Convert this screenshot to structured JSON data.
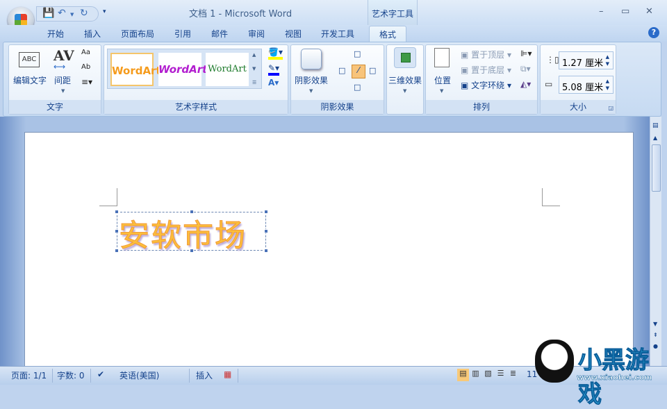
{
  "title": "文档 1 - Microsoft Word",
  "context_tab_group": "艺术字工具",
  "tabs": [
    "开始",
    "插入",
    "页面布局",
    "引用",
    "邮件",
    "审阅",
    "视图",
    "开发工具",
    "格式"
  ],
  "ribbon": {
    "text_group": {
      "label": "文字",
      "edit_text": "编辑文字",
      "spacing": "间距"
    },
    "wordart_styles": {
      "label": "艺术字样式",
      "samples": [
        "WordArt",
        "WordArt",
        "WordArt"
      ]
    },
    "shadow": {
      "label": "阴影效果",
      "button": "阴影效果"
    },
    "threed": {
      "button": "三维效果"
    },
    "arrange": {
      "label": "排列",
      "position": "位置",
      "bring_front": "置于顶层",
      "send_back": "置于底层",
      "text_wrap": "文字环绕"
    },
    "size": {
      "label": "大小",
      "height": "1.27 厘米",
      "width": "5.08 厘米"
    }
  },
  "document": {
    "wordart_text": "安软市场"
  },
  "status": {
    "page": "页面: 1/1",
    "words": "字数: 0",
    "language": "英语(美国)",
    "mode": "插入",
    "zoom": "11"
  },
  "watermark": {
    "text": "小黑游戏",
    "url": "www.xiaohei.com"
  }
}
